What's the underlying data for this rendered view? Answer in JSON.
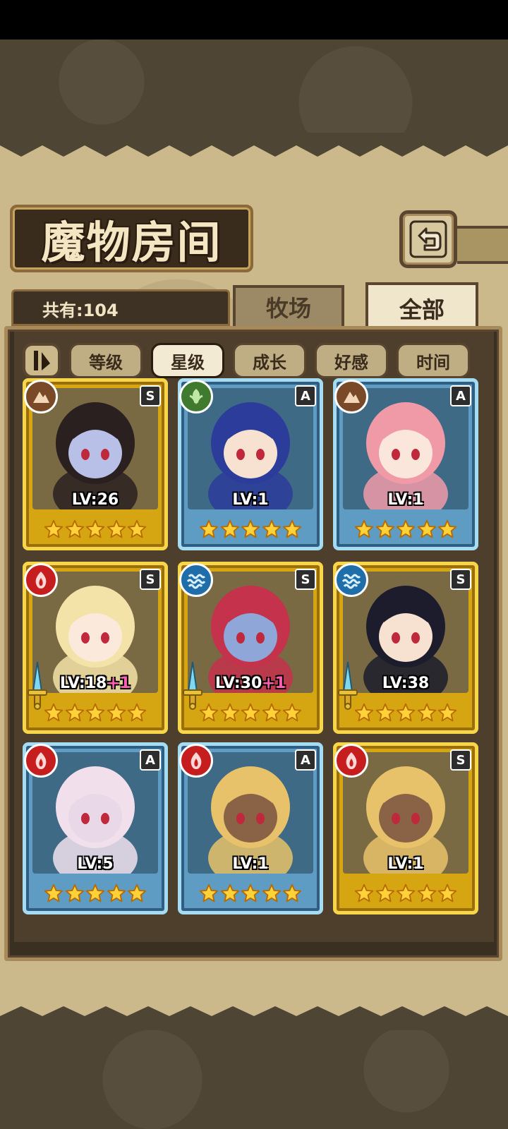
{
  "header": {
    "title": "魔物房间"
  },
  "count": {
    "text": "共有:104"
  },
  "tabs": [
    {
      "label": "牧场",
      "active": false
    },
    {
      "label": "全部",
      "active": true
    }
  ],
  "filters": [
    {
      "label": "等级",
      "active": false
    },
    {
      "label": "星级",
      "active": true
    },
    {
      "label": "成长",
      "active": false
    },
    {
      "label": "好感",
      "active": false
    },
    {
      "label": "时间",
      "active": false
    }
  ],
  "monsters": [
    {
      "element": "earth",
      "rank": "S",
      "frame": "gold",
      "lv": "LV:26",
      "plus": "",
      "stars": 5,
      "sword": false,
      "hair": "#2a2020",
      "skin": "#b9c0e8"
    },
    {
      "element": "wood",
      "rank": "A",
      "frame": "blue",
      "lv": "LV:1",
      "plus": "",
      "stars": 5,
      "sword": false,
      "hair": "#2c3c9a",
      "skin": "#f7e2d2"
    },
    {
      "element": "earth",
      "rank": "A",
      "frame": "blue",
      "lv": "LV:1",
      "plus": "",
      "stars": 5,
      "sword": false,
      "hair": "#f09aa8",
      "skin": "#fbe6dc"
    },
    {
      "element": "fire",
      "rank": "S",
      "frame": "gold",
      "lv": "LV:18",
      "plus": "+1",
      "stars": 5,
      "sword": true,
      "hair": "#f3e3a8",
      "skin": "#fbe9dc"
    },
    {
      "element": "water",
      "rank": "S",
      "frame": "gold",
      "lv": "LV:30",
      "plus": "+1",
      "stars": 5,
      "sword": true,
      "hair": "#c4324c",
      "skin": "#8ea6d8"
    },
    {
      "element": "water",
      "rank": "S",
      "frame": "gold",
      "lv": "LV:38",
      "plus": "",
      "stars": 5,
      "sword": true,
      "hair": "#1c1c2c",
      "skin": "#f7e2d2"
    },
    {
      "element": "fire",
      "rank": "A",
      "frame": "blue",
      "lv": "LV:5",
      "plus": "",
      "stars": 5,
      "sword": false,
      "hair": "#f1e0ec",
      "skin": "#e9d8e8"
    },
    {
      "element": "fire",
      "rank": "A",
      "frame": "blue",
      "lv": "LV:1",
      "plus": "",
      "stars": 5,
      "sword": false,
      "hair": "#e8c26a",
      "skin": "#8a6246"
    },
    {
      "element": "fire",
      "rank": "S",
      "frame": "gold",
      "lv": "LV:1",
      "plus": "",
      "stars": 5,
      "sword": false,
      "hair": "#e8c26a",
      "skin": "#8a6246"
    }
  ]
}
